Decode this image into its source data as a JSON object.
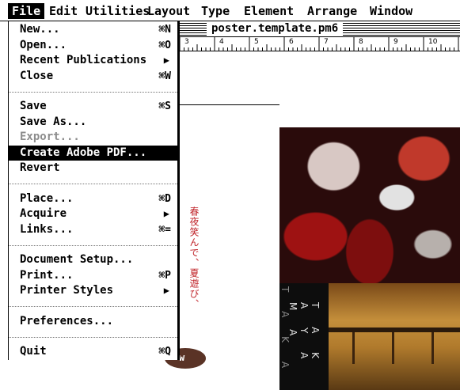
{
  "menubar": {
    "items": [
      "File",
      "Edit",
      "Utilities",
      "Layout",
      "Type",
      "Element",
      "Arrange",
      "Window"
    ]
  },
  "document": {
    "title": "poster.template.pm6",
    "ruler_numbers": [
      "3",
      "4",
      "5",
      "6",
      "7",
      "8",
      "9",
      "10"
    ],
    "japanese_text": "春夜笑んで、夏遊び、",
    "badge_text": "w",
    "vertical_text_1": "T A K A",
    "vertical_text_2": "T A K A Y A M A"
  },
  "file_menu": {
    "items": [
      {
        "label": "New...",
        "shortcut": "⌘N"
      },
      {
        "label": "Open...",
        "shortcut": "⌘O"
      },
      {
        "label": "Recent Publications",
        "shortcut": "▶"
      },
      {
        "label": "Close",
        "shortcut": "⌘W"
      },
      {
        "label": "Save",
        "shortcut": "⌘S"
      },
      {
        "label": "Save As...",
        "shortcut": ""
      },
      {
        "label": "Export...",
        "shortcut": ""
      },
      {
        "label": "Create Adobe PDF...",
        "shortcut": ""
      },
      {
        "label": "Revert",
        "shortcut": ""
      },
      {
        "label": "Place...",
        "shortcut": "⌘D"
      },
      {
        "label": "Acquire",
        "shortcut": "▶"
      },
      {
        "label": "Links...",
        "shortcut": "⌘="
      },
      {
        "label": "Document Setup...",
        "shortcut": ""
      },
      {
        "label": "Print...",
        "shortcut": "⌘P"
      },
      {
        "label": "Printer Styles",
        "shortcut": "▶"
      },
      {
        "label": "Preferences...",
        "shortcut": ""
      },
      {
        "label": "Quit",
        "shortcut": "⌘Q"
      }
    ],
    "highlighted": "Create Adobe PDF...",
    "disabled": [
      "Export..."
    ]
  },
  "colors": {
    "menu_highlight": "#000000",
    "disabled_text": "#8c8c8c",
    "japanese_red": "#c0252b"
  }
}
